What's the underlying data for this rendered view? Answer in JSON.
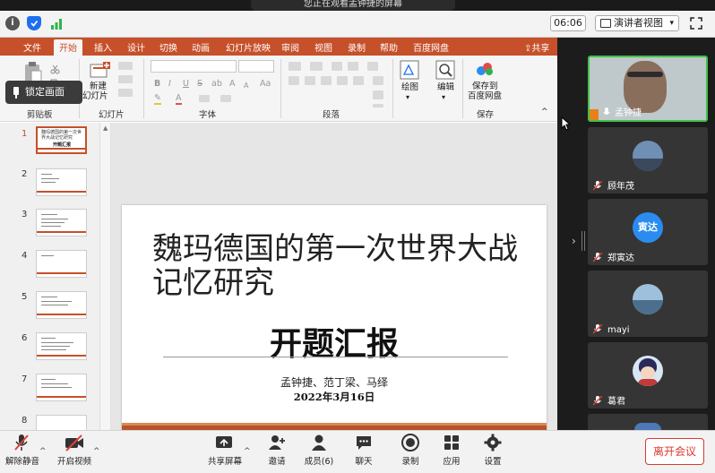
{
  "banner": {
    "text": "您正在观看孟钟捷的屏幕"
  },
  "topbar": {
    "clock": "06:06",
    "view_label": "演讲者视图",
    "view_caret": "▾"
  },
  "ppt": {
    "tabs": [
      "文件",
      "开始",
      "插入",
      "设计",
      "切换",
      "动画",
      "幻灯片放映",
      "审阅",
      "视图",
      "录制",
      "帮助",
      "百度网盘"
    ],
    "share_label": "共享",
    "lock_label": "锁定画面",
    "ribbon": {
      "paste_label": "粘贴",
      "new_slide_label_1": "新建",
      "new_slide_label_2": "幻灯片",
      "draw_label": "绘图",
      "edit_label": "编辑",
      "save_baidu_label_1": "保存到",
      "save_baidu_label_2": "百度网盘",
      "groups": {
        "clipboard": "剪贴板",
        "slides": "幻灯片",
        "font": "字体",
        "paragraph": "段落",
        "save": "保存"
      },
      "font_glyphs": [
        "B",
        "I",
        "U",
        "S",
        "ab",
        "A",
        "A",
        "Aa",
        "A"
      ]
    },
    "thumbs": {
      "numbers": [
        "1",
        "2",
        "3",
        "4",
        "5",
        "6",
        "7",
        "8"
      ],
      "first_title": "魏玛德国的第一次世界大战记忆研究",
      "first_sub": "开题汇报"
    },
    "slide": {
      "title": "魏玛德国的第一次世界大战记忆研究",
      "subtitle": "开题汇报",
      "authors": "孟钟捷、范丁梁、马绎",
      "date": "2022年3月16日"
    }
  },
  "gallery": {
    "participants": [
      {
        "name": "孟钟捷",
        "avatar_text": "",
        "speaking": true
      },
      {
        "name": "顾年茂",
        "avatar_text": "",
        "speaking": false
      },
      {
        "name": "郑寅达",
        "avatar_text": "寅达",
        "speaking": false
      },
      {
        "name": "mayi",
        "avatar_text": "",
        "speaking": false
      },
      {
        "name": "葛君",
        "avatar_text": "",
        "speaking": false
      }
    ]
  },
  "toolbar": {
    "unmute": "解除静音",
    "start_video": "开启视频",
    "share_screen": "共享屏幕",
    "invite": "邀请",
    "members": "成员(6)",
    "chat": "聊天",
    "record": "录制",
    "apps": "应用",
    "settings": "设置",
    "leave": "离开会议"
  },
  "colors": {
    "ppt_accent": "#c6502a",
    "leave_red": "#d83a2e",
    "speaking_green": "#3fc24a",
    "avatar_blue": "#2a8cf0"
  }
}
